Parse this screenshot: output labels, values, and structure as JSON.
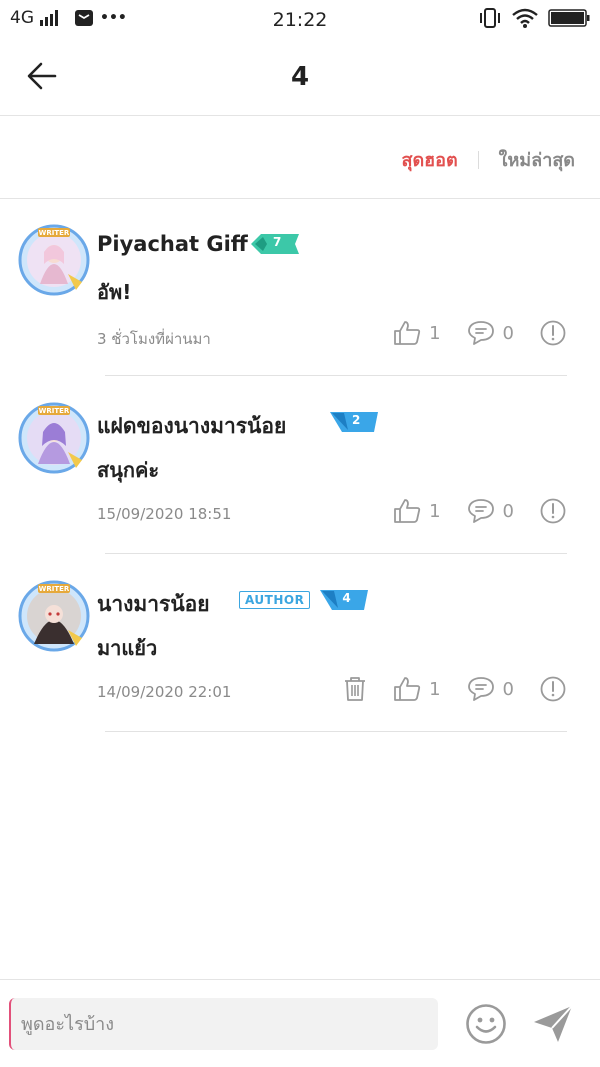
{
  "status_bar": {
    "network": "4G",
    "time": "21:22",
    "more": "•••"
  },
  "header": {
    "title": "4"
  },
  "sort_tabs": {
    "hot": "สุดฮอต",
    "newest": "ใหม่ล่าสุด",
    "active": "hot"
  },
  "comments": [
    {
      "username": "Piyachat Giff",
      "level": "7",
      "level_color": "#3cc8a8",
      "is_author": false,
      "text": "อัพ!",
      "time": "3 ชั่วโมงที่ผ่านมา",
      "likes": "1",
      "replies": "0",
      "can_delete": false
    },
    {
      "username": "แฝดของนางมารน้อย",
      "level": "2",
      "level_color": "#3aa6e8",
      "is_author": false,
      "text": "สนุกค่ะ",
      "time": "15/09/2020 18:51",
      "likes": "1",
      "replies": "0",
      "can_delete": false
    },
    {
      "username": "นางมารน้อย",
      "author_label": "AUTHOR",
      "level": "4",
      "level_color": "#3aa6e8",
      "is_author": true,
      "text": "มาแย้ว",
      "time": "14/09/2020 22:01",
      "likes": "1",
      "replies": "0",
      "can_delete": true
    }
  ],
  "input": {
    "placeholder": "พูดอะไรบ้าง"
  },
  "icons": {
    "back": "arrow-left-icon",
    "like": "thumbs-up-icon",
    "reply": "chat-bubble-icon",
    "report": "exclamation-circle-icon",
    "delete": "trash-icon",
    "emoji": "smiley-icon",
    "send": "paper-plane-icon"
  },
  "colors": {
    "accent_hot": "#e2504f",
    "muted": "#9a9a9a",
    "author_badge": "#3ba6e0"
  }
}
